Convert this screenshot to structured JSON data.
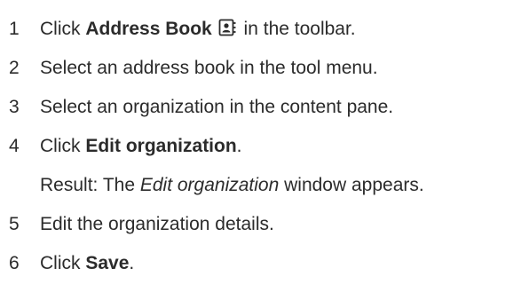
{
  "steps": [
    {
      "number": "1",
      "prefix": "Click ",
      "bold": "Address Book",
      "suffix": " in the toolbar.",
      "icon": "address-book-icon"
    },
    {
      "number": "2",
      "text": "Select an address book in the tool menu."
    },
    {
      "number": "3",
      "text": "Select an organization in the content pane."
    },
    {
      "number": "4",
      "prefix": "Click ",
      "bold": "Edit organization",
      "suffix": "."
    },
    {
      "result_prefix": "Result: The ",
      "result_italic": "Edit organization",
      "result_suffix": " window appears."
    },
    {
      "number": "5",
      "text": "Edit the organization details."
    },
    {
      "number": "6",
      "prefix": "Click ",
      "bold": "Save",
      "suffix": "."
    }
  ]
}
